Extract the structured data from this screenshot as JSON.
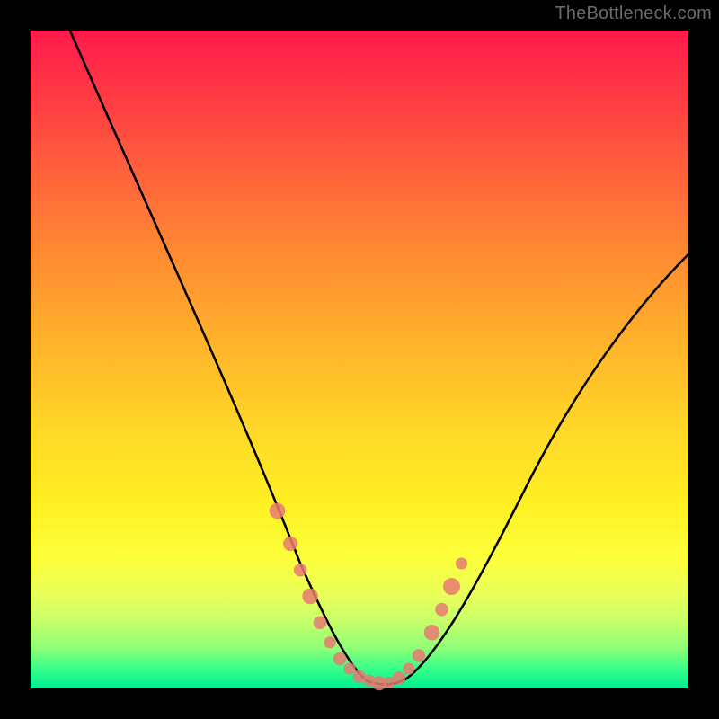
{
  "watermark": "TheBottleneck.com",
  "chart_data": {
    "type": "line",
    "title": "",
    "xlabel": "",
    "ylabel": "",
    "xlim": [
      0,
      100
    ],
    "ylim": [
      0,
      100
    ],
    "series": [
      {
        "name": "curve",
        "x": [
          6,
          10,
          15,
          20,
          25,
          30,
          34,
          38,
          41,
          43,
          45,
          47,
          49,
          52,
          55,
          58,
          62,
          66,
          70,
          75,
          80,
          85,
          90,
          95,
          100
        ],
        "y": [
          100,
          90,
          78,
          66,
          55,
          44,
          35,
          26,
          19,
          14,
          10,
          6,
          3,
          1,
          1,
          3,
          8,
          15,
          23,
          32,
          41,
          49,
          56,
          62,
          67
        ]
      }
    ],
    "markers": {
      "name": "highlight-points",
      "x": [
        38,
        40,
        42,
        44,
        46,
        48,
        50,
        52,
        54,
        56,
        58,
        60,
        62,
        64
      ],
      "y": [
        26,
        21,
        16,
        11,
        7,
        4,
        2,
        1,
        1,
        2,
        4,
        7,
        11,
        16
      ],
      "color": "#e77a72",
      "size_range": [
        3,
        8
      ]
    },
    "background": {
      "gradient": [
        "#ff1a4c",
        "#ffb42a",
        "#fff022",
        "#00f090"
      ],
      "direction": "vertical"
    }
  }
}
